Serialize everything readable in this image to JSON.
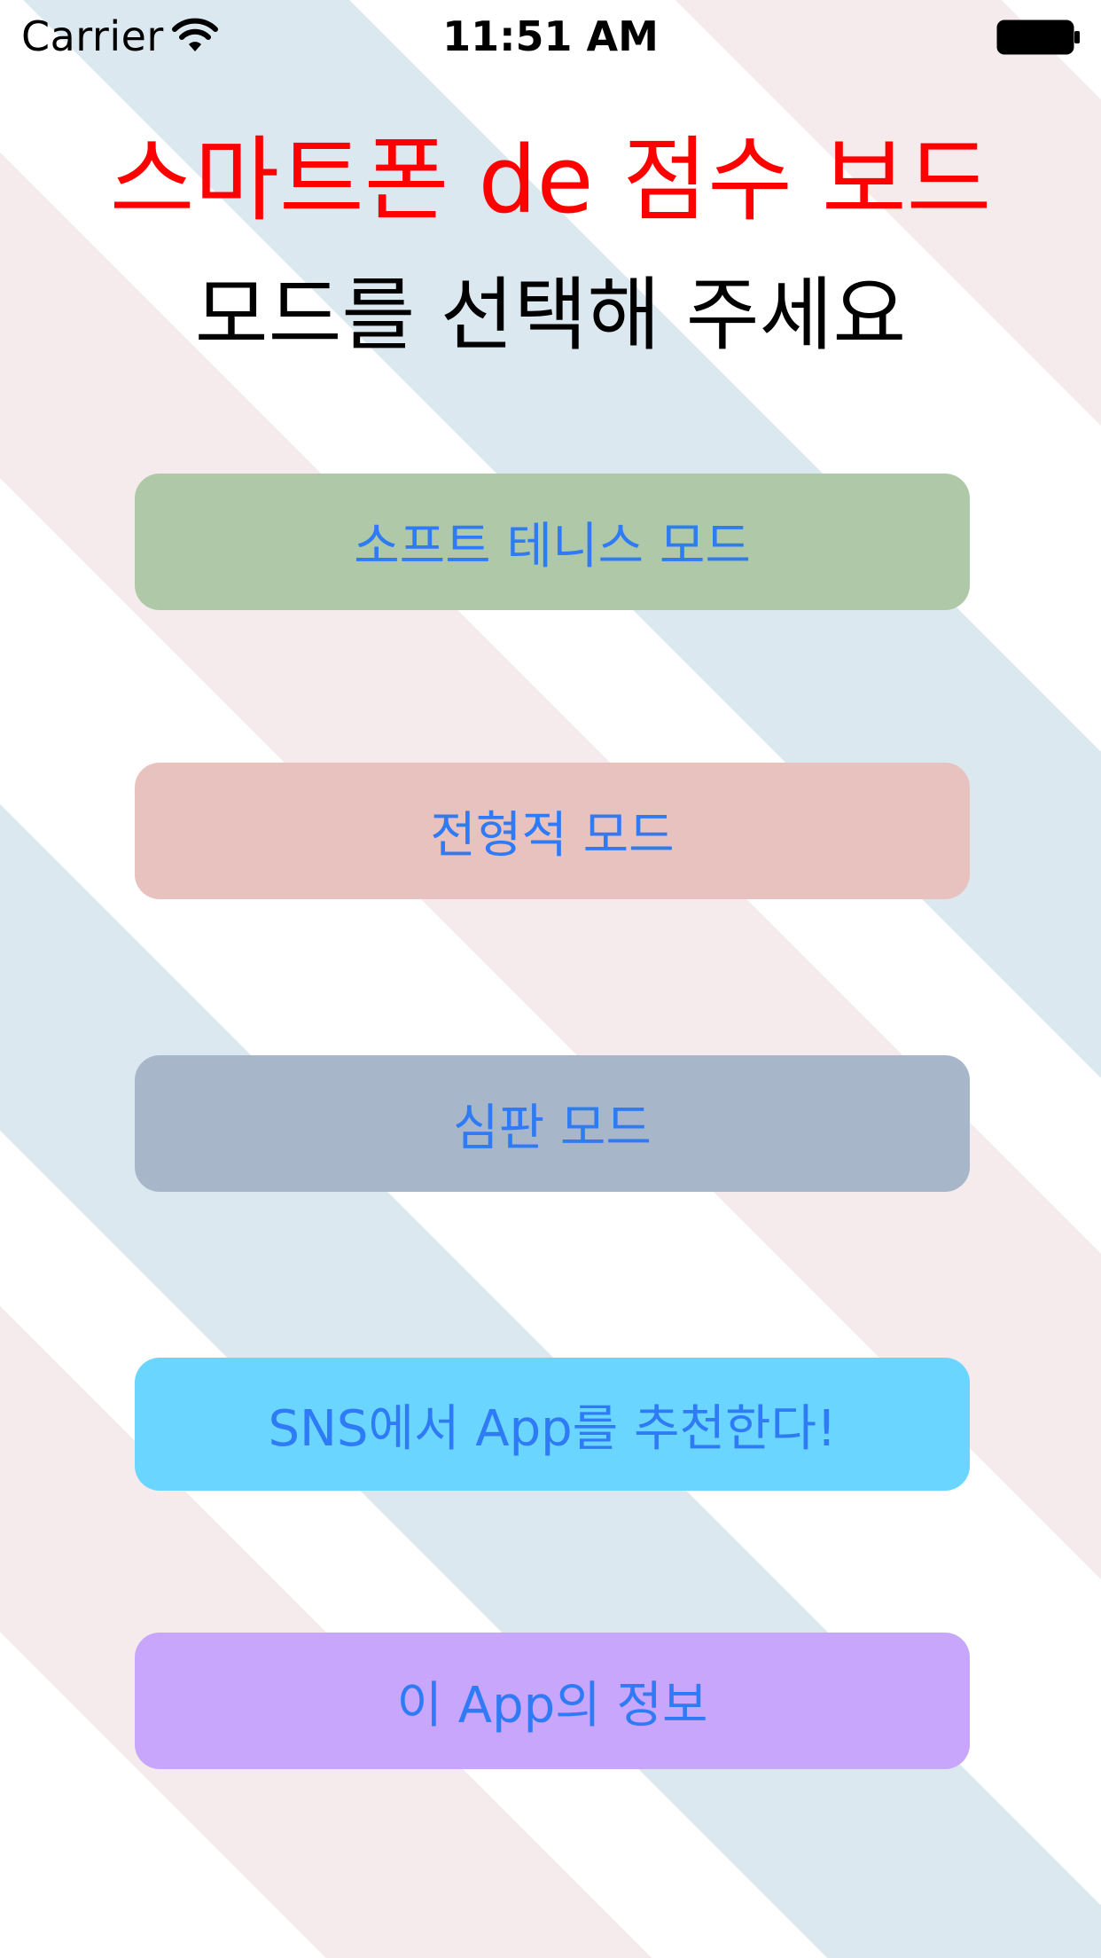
{
  "status_bar": {
    "carrier": "Carrier",
    "time": "11:51 AM"
  },
  "header": {
    "title": "스마트폰 de 점수 보드",
    "subtitle": "모드를 선택해 주세요",
    "title_color": "#ff0000"
  },
  "buttons": [
    {
      "label": "소프트 테니스 모드",
      "color": "#afc9a8"
    },
    {
      "label": "전형적 모드",
      "color": "#e8c2be"
    },
    {
      "label": "심판 모드",
      "color": "#a8b6c9"
    },
    {
      "label": "SNS에서 App를 추천한다!",
      "color": "#6ad6ff"
    },
    {
      "label": "이 App의 정보",
      "color": "#c7a6fc"
    }
  ],
  "button_text_color": "#2f7bf6",
  "icons": [
    "wifi-icon",
    "battery-icon"
  ]
}
